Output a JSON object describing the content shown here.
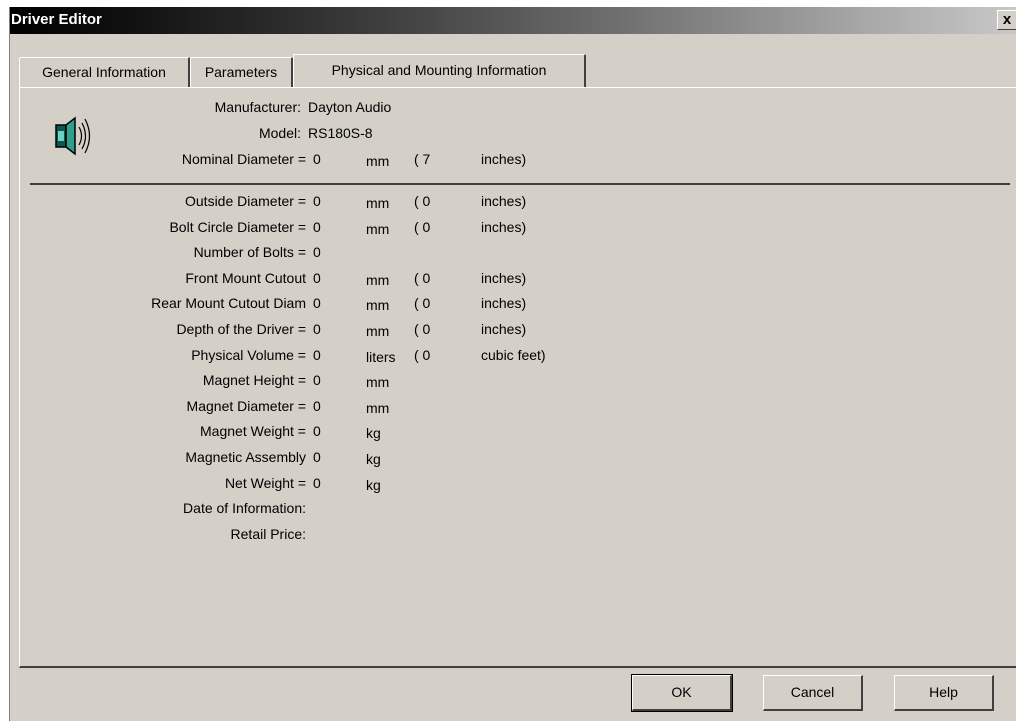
{
  "window": {
    "title": "Driver Editor",
    "close_glyph": "x"
  },
  "tabs": [
    {
      "label": "General Information"
    },
    {
      "label": "Parameters"
    },
    {
      "label": "Physical and Mounting Information"
    }
  ],
  "header": {
    "icon": "speaker-icon",
    "manufacturer_label": "Manufacturer:",
    "manufacturer_value": "Dayton Audio",
    "model_label": "Model:",
    "model_value": "RS180S-8",
    "nominal": {
      "label": "Nominal Diameter =",
      "value": "0",
      "unit": "mm",
      "paren": "( 7",
      "alt_unit": "inches)"
    }
  },
  "fields": [
    {
      "label": "Outside Diameter =",
      "value": "0",
      "unit": "mm",
      "paren": "( 0",
      "alt_unit": "inches)"
    },
    {
      "label": "Bolt Circle Diameter =",
      "value": "0",
      "unit": "mm",
      "paren": "( 0",
      "alt_unit": "inches)"
    },
    {
      "label": "Number of Bolts =",
      "value": "0",
      "unit": "",
      "paren": "",
      "alt_unit": ""
    },
    {
      "label": "Front Mount Cutout",
      "value": "0",
      "unit": "mm",
      "paren": "( 0",
      "alt_unit": "inches)"
    },
    {
      "label": "Rear Mount Cutout Diam",
      "value": "0",
      "unit": "mm",
      "paren": "( 0",
      "alt_unit": "inches)"
    },
    {
      "label": "Depth of the Driver =",
      "value": "0",
      "unit": "mm",
      "paren": "( 0",
      "alt_unit": "inches)"
    },
    {
      "label": "Physical Volume =",
      "value": "0",
      "unit": "liters",
      "paren": "( 0",
      "alt_unit": "cubic feet)"
    },
    {
      "label": "Magnet Height =",
      "value": "0",
      "unit": "mm",
      "paren": "",
      "alt_unit": ""
    },
    {
      "label": "Magnet Diameter =",
      "value": "0",
      "unit": "mm",
      "paren": "",
      "alt_unit": ""
    },
    {
      "label": "Magnet Weight =",
      "value": "0",
      "unit": "kg",
      "paren": "",
      "alt_unit": ""
    },
    {
      "label": "Magnetic Assembly",
      "value": "0",
      "unit": "kg",
      "paren": "",
      "alt_unit": ""
    },
    {
      "label": "Net Weight =",
      "value": "0",
      "unit": "kg",
      "paren": "",
      "alt_unit": ""
    },
    {
      "label": "Date of Information:",
      "value": "",
      "unit": "",
      "paren": "",
      "alt_unit": ""
    },
    {
      "label": "Retail Price:",
      "value": "",
      "unit": "",
      "paren": "",
      "alt_unit": ""
    }
  ],
  "buttons": {
    "ok": "OK",
    "cancel": "Cancel",
    "help": "Help"
  }
}
